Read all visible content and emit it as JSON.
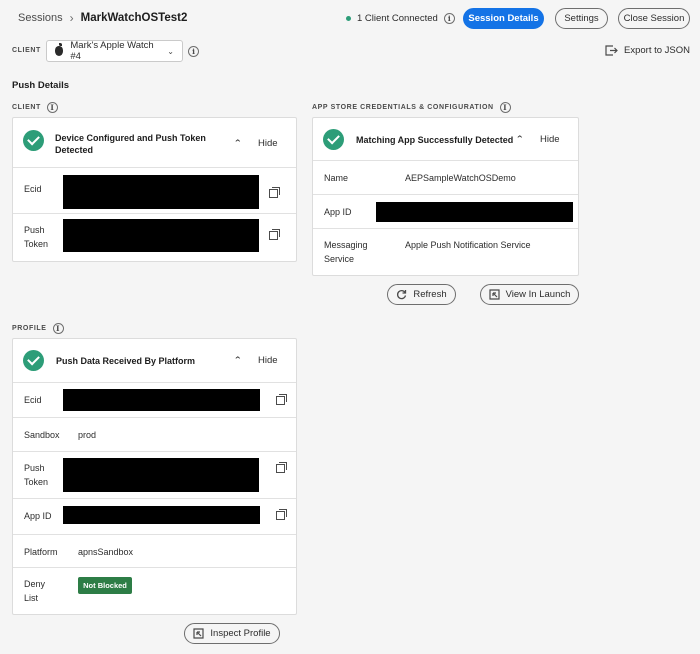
{
  "header": {
    "breadcrumb_root": "Sessions",
    "breadcrumb_sep": "›",
    "session_name": "MarkWatchOSTest2",
    "connection_status": "1 Client Connected",
    "session_details_label": "Session Details",
    "settings_label": "Settings",
    "close_session_label": "Close Session"
  },
  "client_bar": {
    "label": "CLIENT",
    "selected_client": "Mark's Apple Watch #4",
    "export_label": "Export to JSON"
  },
  "page_title": "Push Details",
  "client_section": {
    "label": "CLIENT",
    "card": {
      "title": "Device Configured and Push Token Detected",
      "hide_label": "Hide",
      "rows": [
        {
          "key": "Ecid"
        },
        {
          "key": "Push Token"
        }
      ]
    }
  },
  "appstore_section": {
    "label": "APP STORE CREDENTIALS & CONFIGURATION",
    "card": {
      "title": "Matching App Successfully Detected",
      "hide_label": "Hide",
      "rows": [
        {
          "key": "Name",
          "value": "AEPSampleWatchOSDemo"
        },
        {
          "key": "App ID"
        },
        {
          "key": "Messaging Service",
          "value": "Apple Push Notification Service"
        }
      ]
    },
    "refresh_label": "Refresh",
    "view_in_launch_label": "View In Launch"
  },
  "profile_section": {
    "label": "PROFILE",
    "card": {
      "title": "Push Data Received By Platform",
      "hide_label": "Hide",
      "rows": [
        {
          "key": "Ecid"
        },
        {
          "key": "Sandbox",
          "value": "prod"
        },
        {
          "key": "Push Token"
        },
        {
          "key": "App ID"
        },
        {
          "key": "Platform",
          "value": "apnsSandbox"
        },
        {
          "key": "Deny List",
          "badge": "Not Blocked"
        }
      ]
    },
    "inspect_label": "Inspect Profile"
  },
  "colors": {
    "accent": "#1473e6",
    "success": "#2d9d78",
    "badge": "#2d7d46"
  },
  "icons": {
    "apple": "apple-icon",
    "info": "info-icon",
    "check": "checkmark-circle-icon",
    "copy": "copy-icon",
    "export": "export-icon",
    "refresh": "refresh-icon",
    "launch": "launch-icon"
  }
}
